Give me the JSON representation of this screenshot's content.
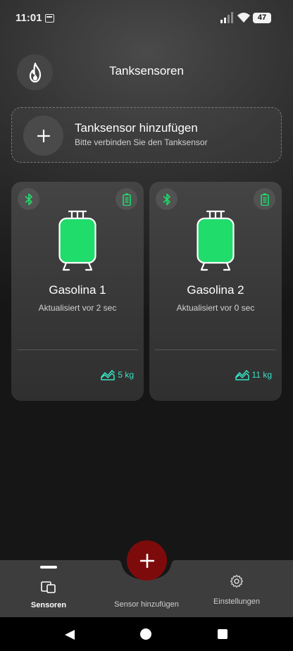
{
  "status_bar": {
    "time": "11:01",
    "battery": "47",
    "icons": [
      "notification-icon",
      "signal-icon",
      "wifi-icon",
      "battery-icon"
    ]
  },
  "header": {
    "title": "Tanksensoren",
    "logo_icon": "flame-icon"
  },
  "add_sensor": {
    "title": "Tanksensor hinzufügen",
    "subtitle": "Bitte verbinden Sie den Tanksensor",
    "icon": "plus-icon"
  },
  "sensors": [
    {
      "name": "Gasolina 1",
      "updated": "Aktualisiert vor 2 sec",
      "weight": "5 kg"
    },
    {
      "name": "Gasolina 2",
      "updated": "Aktualisiert vor 0 sec",
      "weight": "11 kg"
    }
  ],
  "bottom_nav": {
    "sensoren": "Sensoren",
    "add": "Sensor hinzufügen",
    "settings": "Einstellungen",
    "active": "Sensoren"
  },
  "colors": {
    "accent_green": "#1fdc6b",
    "accent_teal": "#39e3c4",
    "fab_red": "#7e0b0b",
    "card_bg": "#3d3d3d"
  }
}
